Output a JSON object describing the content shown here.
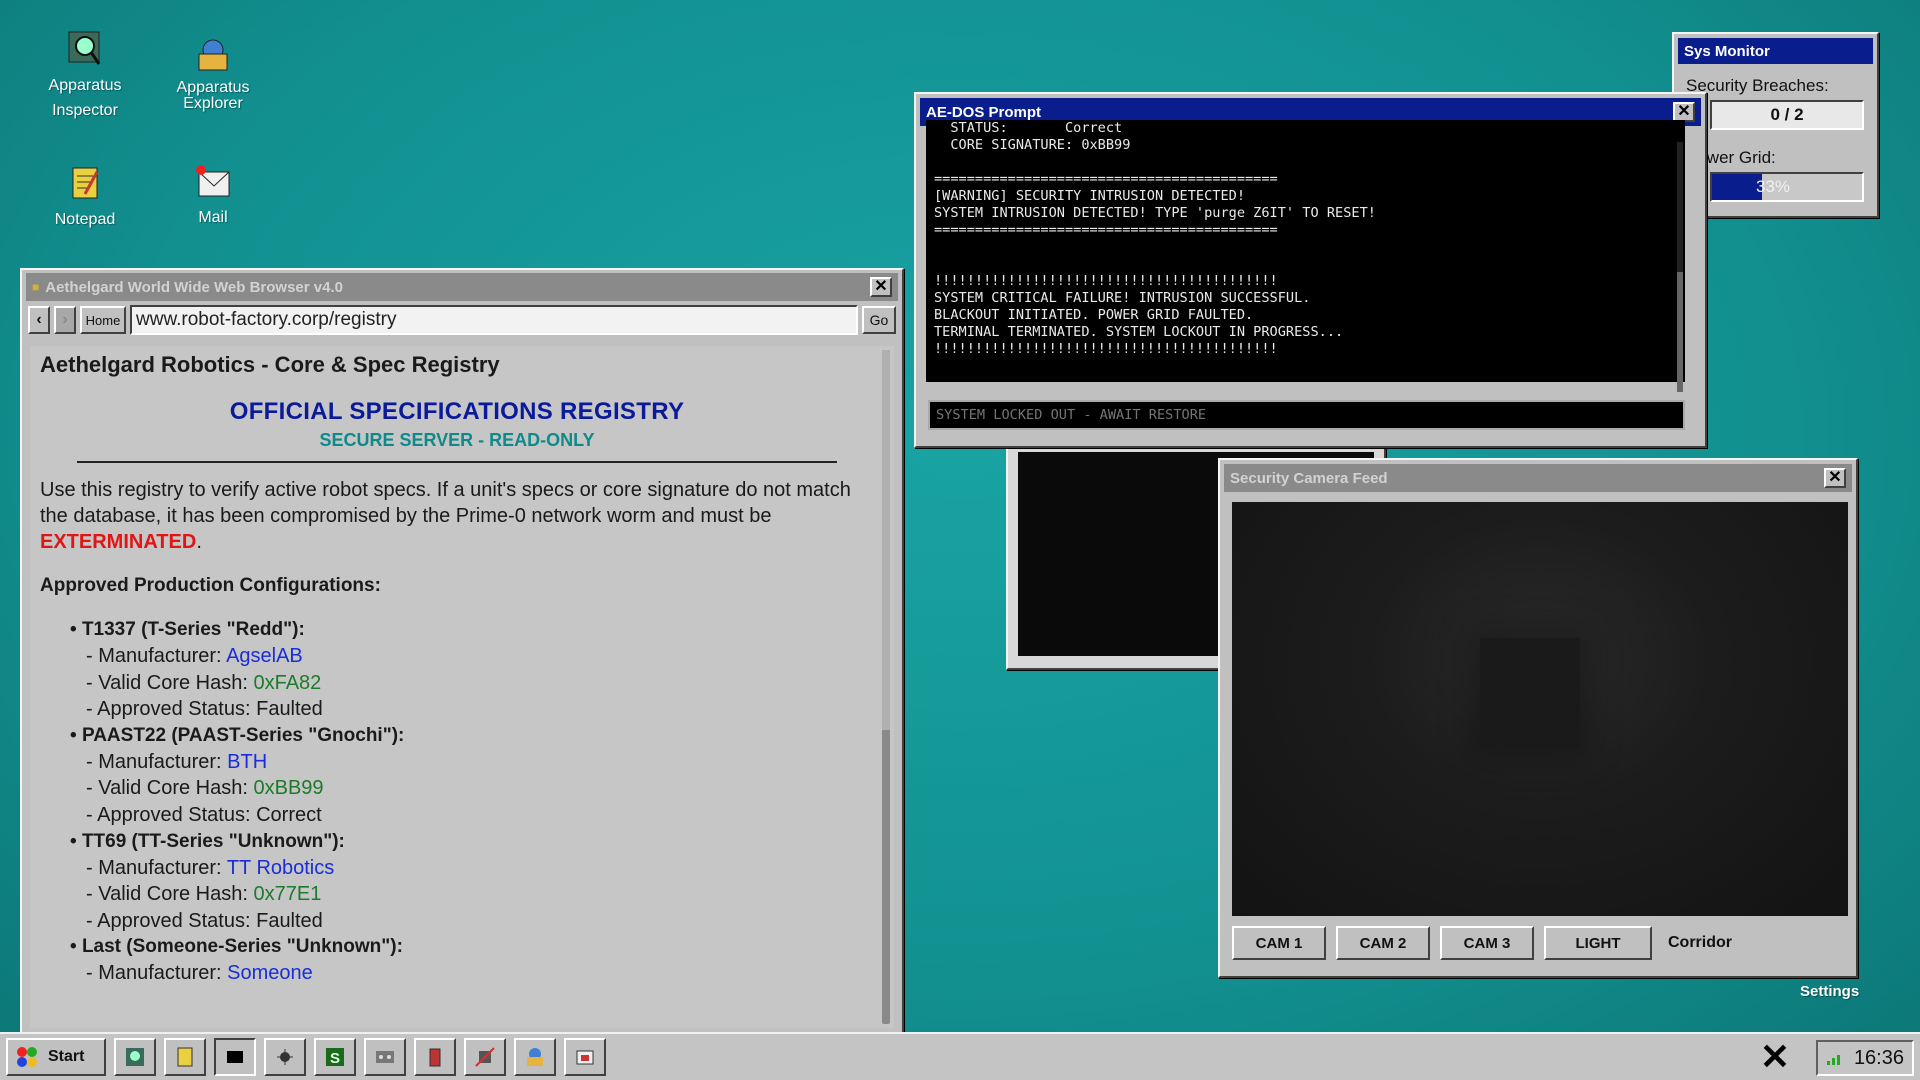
{
  "desktop": {
    "icons": [
      {
        "label": "Apparatus Inspector",
        "name": "inspector-icon"
      },
      {
        "label": "Apparatus Explorer",
        "name": "explorer-icon"
      },
      {
        "label": "Notepad",
        "name": "notepad-icon"
      },
      {
        "label": "Mail",
        "name": "mail-icon"
      }
    ],
    "settings_label": "Settings"
  },
  "sysmon": {
    "title": "Sys Monitor",
    "breaches_label": "Security Breaches:",
    "breaches_value": "0 / 2",
    "power_label": "Power Grid:",
    "power_value": "33%",
    "power_fraction": 0.33
  },
  "browser": {
    "title": "Aethelgard World Wide Web Browser v4.0",
    "back": "‹",
    "forward": "›",
    "home": "Home",
    "url": "www.robot-factory.corp/registry",
    "go": "Go",
    "page": {
      "title": "Aethelgard Robotics - Core & Spec Registry",
      "heading": "OFFICIAL SPECIFICATIONS REGISTRY",
      "subheading": "SECURE SERVER - READ-ONLY",
      "intro": "Use this registry to verify active robot specs. If a unit's specs or core signature do not match the database, it has been compromised by the Prime-0 network worm and must be ",
      "intro_warning": "EXTERMINATED",
      "intro_end": ".",
      "configs_heading": "Approved Production Configurations:",
      "units": [
        {
          "name": "T1337 (T-Series \"Redd\"):",
          "manufacturer_label": "- Manufacturer: ",
          "manufacturer": "AgselAB",
          "hash_label": "- Valid Core Hash: ",
          "hash": "0xFA82",
          "status": "- Approved Status: Faulted"
        },
        {
          "name": "PAAST22 (PAAST-Series \"Gnochi\"):",
          "manufacturer_label": "- Manufacturer: ",
          "manufacturer": "BTH",
          "hash_label": "- Valid Core Hash: ",
          "hash": "0xBB99",
          "status": "- Approved Status: Correct"
        },
        {
          "name": "TT69 (TT-Series \"Unknown\"):",
          "manufacturer_label": "- Manufacturer: ",
          "manufacturer": "TT Robotics",
          "hash_label": "- Valid Core Hash: ",
          "hash": "0x77E1",
          "status": "- Approved Status: Faulted"
        },
        {
          "name": "Last (Someone-Series \"Unknown\"):",
          "manufacturer_label": "- Manufacturer: ",
          "manufacturer": "Someone"
        }
      ]
    }
  },
  "terminal": {
    "title": "AE-DOS Prompt",
    "lines": [
      "  STATUS:       Correct",
      "  CORE SIGNATURE: 0xBB99",
      "",
      "==========================================",
      "[WARNING] SECURITY INTRUSION DETECTED!",
      "SYSTEM INTRUSION DETECTED! TYPE 'purge Z6IT' TO RESET!",
      "==========================================",
      "",
      "",
      "!!!!!!!!!!!!!!!!!!!!!!!!!!!!!!!!!!!!!!!!!!",
      "SYSTEM CRITICAL FAILURE! INTRUSION SUCCESSFUL.",
      "BLACKOUT INITIATED. POWER GRID FAULTED.",
      "TERMINAL TERMINATED. SYSTEM LOCKOUT IN PROGRESS...",
      "!!!!!!!!!!!!!!!!!!!!!!!!!!!!!!!!!!!!!!!!!!"
    ],
    "input_placeholder": "SYSTEM LOCKED OUT - AWAIT RESTORE"
  },
  "camera": {
    "title": "Security Camera Feed",
    "buttons": [
      "CAM 1",
      "CAM 2",
      "CAM 3",
      "LIGHT"
    ],
    "location": "Corridor"
  },
  "taskbar": {
    "start": "Start",
    "apps": [
      "inspector-icon",
      "notepad-icon",
      "terminal-icon",
      "bug-icon",
      "s-icon",
      "cassette-icon",
      "battery-icon",
      "chip-icon",
      "explorer-icon",
      "mail-icon"
    ],
    "time": "16:36"
  },
  "colors": {
    "desktop": "#129090",
    "title_active": "#0a1d8c",
    "title_inactive": "#8a8a8a",
    "warning_red": "#e01616",
    "link_blue": "#1a2dd6",
    "hash_green": "#1d7a2a"
  }
}
